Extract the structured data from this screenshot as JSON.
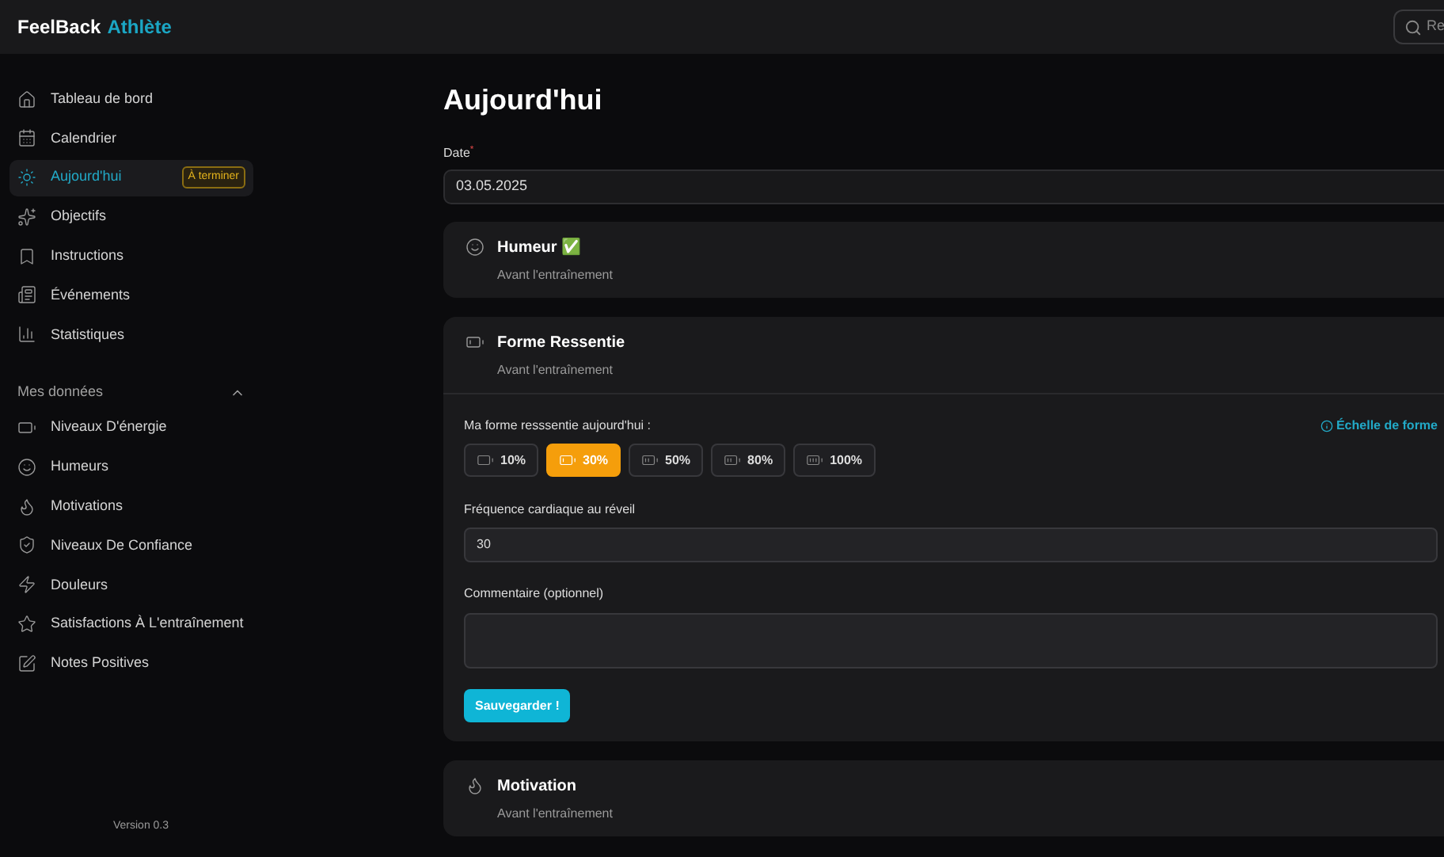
{
  "header": {
    "logo": {
      "first": "FeelBack",
      "second": "Athlète"
    },
    "search": {
      "placeholder": "Re"
    }
  },
  "sidebar": {
    "items": [
      {
        "label": "Tableau de bord",
        "selected": false
      },
      {
        "label": "Calendrier",
        "selected": false
      },
      {
        "label": "Aujourd'hui",
        "selected": true,
        "badge": "À terminer"
      },
      {
        "label": "Objectifs",
        "selected": false
      },
      {
        "label": "Instructions",
        "selected": false
      },
      {
        "label": "Événements",
        "selected": false
      },
      {
        "label": "Statistiques",
        "selected": false
      }
    ],
    "section": {
      "title": "Mes données",
      "expanded": true,
      "items": [
        {
          "label": "Niveaux D'énergie"
        },
        {
          "label": "Humeurs"
        },
        {
          "label": "Motivations"
        },
        {
          "label": "Niveaux De Confiance"
        },
        {
          "label": "Douleurs"
        },
        {
          "label": "Satisfactions À L'entraînement"
        },
        {
          "label": "Notes Positives"
        }
      ]
    },
    "version": "Version 0.3"
  },
  "main": {
    "title": "Aujourd'hui",
    "date": {
      "label": "Date",
      "required_mark": "*",
      "value": "03.05.2025"
    },
    "cards": [
      {
        "title": "Humeur ✅",
        "subtitle": "Avant l'entraînement"
      },
      {
        "title": "Forme Ressentie",
        "subtitle": "Avant l'entraînement",
        "expanded": true,
        "form": {
          "question": "Ma forme resssentie aujourd'hui :",
          "scale_link": "Échelle de forme",
          "options": [
            {
              "label": "10%",
              "selected": false
            },
            {
              "label": "30%",
              "selected": true
            },
            {
              "label": "50%",
              "selected": false
            },
            {
              "label": "80%",
              "selected": false
            },
            {
              "label": "100%",
              "selected": false
            }
          ],
          "heart_rate": {
            "label": "Fréquence cardiaque au réveil",
            "value": "30"
          },
          "comment": {
            "label": "Commentaire (optionnel)"
          },
          "save": "Sauvegarder !"
        }
      },
      {
        "title": "Motivation",
        "subtitle": "Avant l'entraînement"
      }
    ]
  }
}
